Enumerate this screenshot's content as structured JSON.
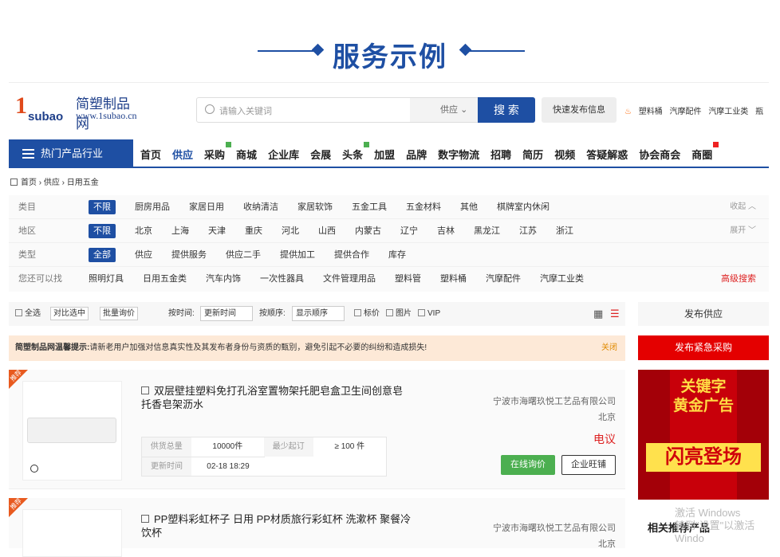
{
  "banner_title": "服务示例",
  "logo": {
    "big": "1",
    "sub": "subao",
    "name": "简塑制品网",
    "url": "www.1subao.cn"
  },
  "search": {
    "placeholder": "请输入关键词",
    "type": "供应",
    "button": "搜 索"
  },
  "quick_publish": "快速发布信息",
  "hot_words": [
    "塑料桶",
    "汽摩配件",
    "汽摩工业类",
    "瓶"
  ],
  "nav": {
    "category_label": "热门产品行业",
    "items": [
      "首页",
      "供应",
      "采购",
      "商城",
      "企业库",
      "会展",
      "头条",
      "加盟",
      "品牌",
      "数字物流",
      "招聘",
      "简历",
      "视频",
      "答疑解惑",
      "协会商会",
      "商圈"
    ]
  },
  "breadcrumb": [
    "首页",
    "供应",
    "日用五金"
  ],
  "filters": {
    "category": {
      "label": "类目",
      "options": [
        "不限",
        "厨房用品",
        "家居日用",
        "收纳清洁",
        "家居软饰",
        "五金工具",
        "五金材料",
        "其他",
        "棋牌室内休闲"
      ],
      "right": "收起"
    },
    "region": {
      "label": "地区",
      "options": [
        "不限",
        "北京",
        "上海",
        "天津",
        "重庆",
        "河北",
        "山西",
        "内蒙古",
        "辽宁",
        "吉林",
        "黑龙江",
        "江苏",
        "浙江"
      ],
      "right": "展开"
    },
    "type": {
      "label": "类型",
      "options": [
        "全部",
        "供应",
        "提供服务",
        "供应二手",
        "提供加工",
        "提供合作",
        "库存"
      ]
    },
    "suggest": {
      "label": "您还可以找",
      "options": [
        "照明灯具",
        "日用五金类",
        "汽车内饰",
        "一次性器具",
        "文件管理用品",
        "塑料管",
        "塑料桶",
        "汽摩配件",
        "汽摩工业类"
      ],
      "right": "高级搜索"
    }
  },
  "toolbar": {
    "select_all": "全选",
    "compare": "对比选中",
    "batch": "批量询价",
    "time_label": "按时间:",
    "time_value": "更新时间",
    "order_label": "按顺序:",
    "order_value": "显示顺序",
    "chk_price": "标价",
    "chk_image": "图片",
    "chk_vip": "VIP"
  },
  "notice": {
    "bold": "简塑制品网温馨提示:",
    "text": "请新老用户加强对信息真实性及其发布者身份与资质的甄别，避免引起不必要的纠纷和造成损失!",
    "close": "关闭"
  },
  "products": [
    {
      "tag": "推荐",
      "title": "双层壁挂塑料免打孔浴室置物架托肥皂盒卫生间创意皂托香皂架沥水",
      "company": "宁波市海曙玖悦工艺品有限公司",
      "city": "北京",
      "price": "电议",
      "supply_k": "供货总量",
      "supply_v": "10000件",
      "min_k": "最少起订",
      "min_v": "≥ 100 件",
      "update_k": "更新时间",
      "update_v": "02-18 18:29",
      "btn_inquiry": "在线询价",
      "btn_chat": "企业旺铺"
    },
    {
      "tag": "推荐",
      "title": "PP塑料彩虹杯子 日用 PP材质旅行彩虹杯 洗漱杯 聚餐冷饮杯",
      "company": "宁波市海曙玖悦工艺品有限公司",
      "city": "北京"
    }
  ],
  "sidebar": {
    "publish": "发布供应",
    "urgent": "发布紧急采购",
    "ad_line1": "关键字",
    "ad_line2": "黄金广告",
    "ad_big": "闪亮登场",
    "related": "相关推荐产品"
  },
  "watermark": {
    "line1": "激活 Windows",
    "line2": "转到\"设置\"以激活 Windo"
  }
}
